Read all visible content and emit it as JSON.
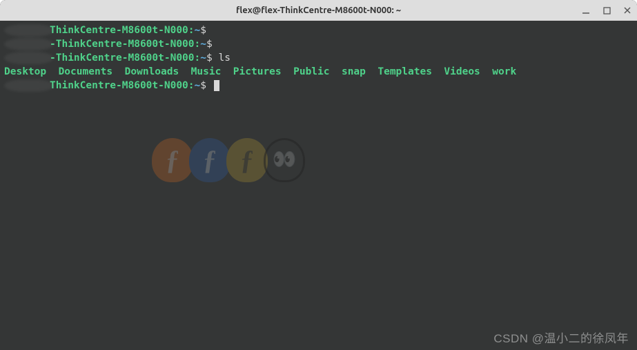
{
  "titlebar": {
    "title": "flex@flex-ThinkCentre-M8600t-N000: ~"
  },
  "prompt": {
    "host": "ThinkCentre-M8600t-N000",
    "path": "~",
    "sep1": ":",
    "dollar": "$"
  },
  "lines": {
    "cmd_ls": "ls"
  },
  "ls_output": {
    "d0": "Desktop",
    "d1": "Documents",
    "d2": "Downloads",
    "d3": "Music",
    "d4": "Pictures",
    "d5": "Public",
    "d6": "snap",
    "d7": "Templates",
    "d8": "Videos",
    "d9": "work"
  },
  "watermark": {
    "csdn": "CSDN @温小二的徐凤年"
  }
}
